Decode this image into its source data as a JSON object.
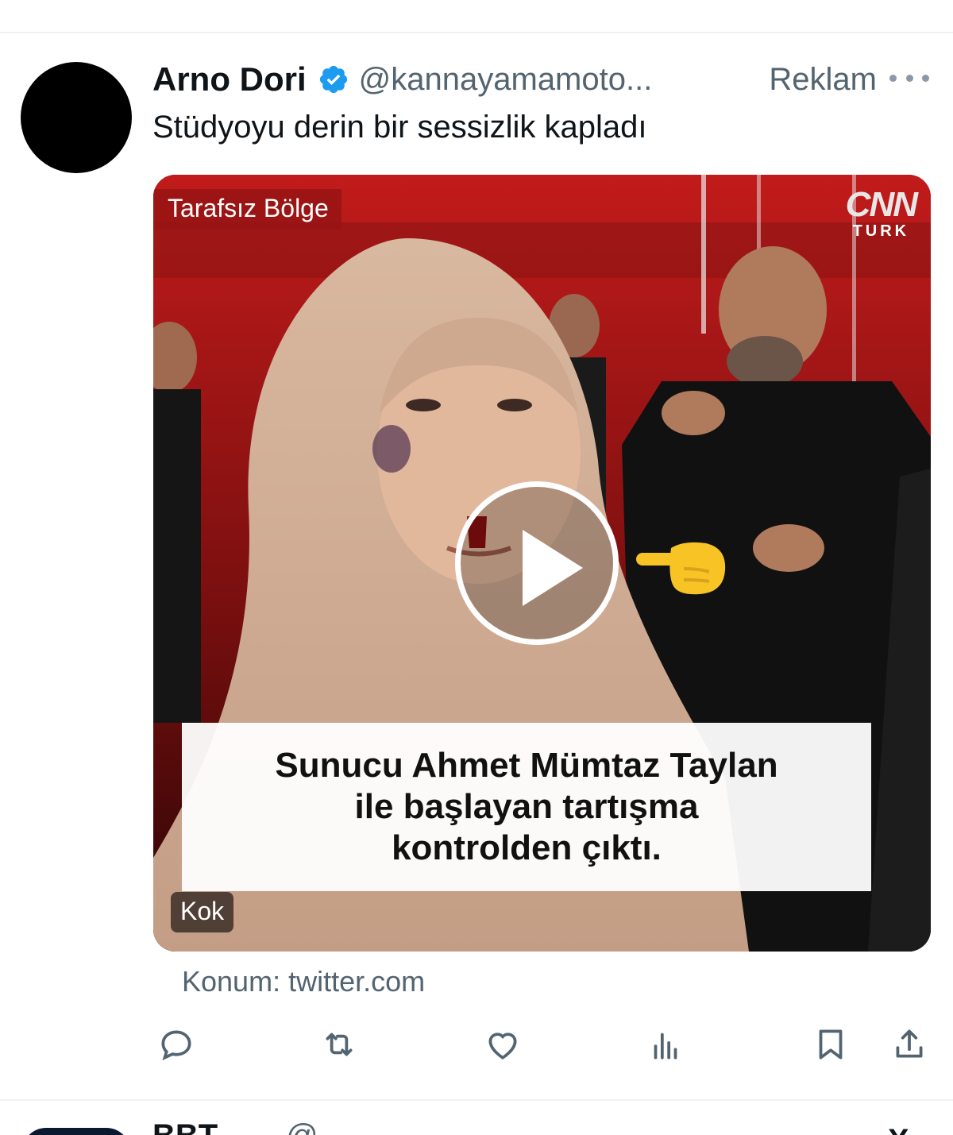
{
  "post": {
    "author_name": "Arno Dori",
    "handle": "@kannayamamoto...",
    "ad_label": "Reklam",
    "text": "Stüdyoyu derin bir sessizlik kapladı",
    "verified": true,
    "verified_color": "#1d9bf0"
  },
  "media": {
    "program_label": "Tarafsız Bölge",
    "channel_logo_top": "CNN",
    "channel_logo_bottom": "TURK",
    "caption_lines": [
      "Sunucu Ahmet Mümtaz Taylan",
      "ile başlayan tartışma",
      "kontrolden çıktı."
    ],
    "source_chip": "Kok",
    "overlay_emoji": "👉",
    "play_icon": "play-icon"
  },
  "location": "Konum: twitter.com",
  "actions": [
    {
      "name": "reply",
      "icon": "reply-icon"
    },
    {
      "name": "retweet",
      "icon": "retweet-icon"
    },
    {
      "name": "like",
      "icon": "heart-icon"
    },
    {
      "name": "views",
      "icon": "analytics-icon"
    },
    {
      "name": "bookmark",
      "icon": "bookmark-icon"
    },
    {
      "name": "share",
      "icon": "share-icon"
    }
  ],
  "next_post": {
    "author_name": "BBT",
    "handle": "@...",
    "close_glyph": "X"
  },
  "colors": {
    "text_primary": "#0f1419",
    "text_secondary": "#536471",
    "divider": "#eff3f4",
    "studio_red": "#b01818"
  }
}
